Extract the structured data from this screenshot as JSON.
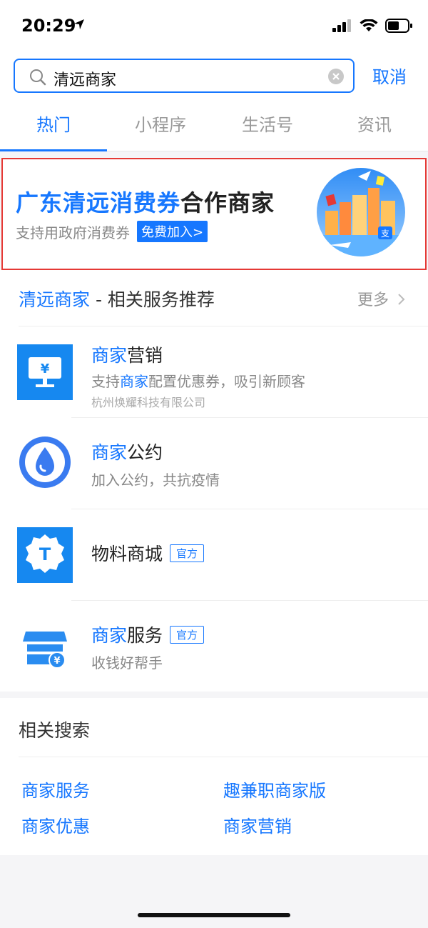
{
  "status": {
    "time": "20:29"
  },
  "search": {
    "query": "清远商家",
    "cancel_label": "取消"
  },
  "tabs": [
    {
      "label": "热门"
    },
    {
      "label": "小程序"
    },
    {
      "label": "生活号"
    },
    {
      "label": "资讯"
    }
  ],
  "banner": {
    "title_highlight": "广东清远消费券",
    "title_rest": "合作商家",
    "subtitle": "支持用政府消费券",
    "join_label": "免费加入>"
  },
  "services": {
    "title_highlight": "清远商家",
    "title_rest": " - 相关服务推荐",
    "more_label": "更多",
    "items": [
      {
        "title_hl": "商家",
        "title_rest": "营销",
        "desc_a": "支持",
        "desc_hl": "商家",
        "desc_b": "配置优惠券，吸引新顾客",
        "company": "杭州焕耀科技有限公司"
      },
      {
        "title_hl": "商家",
        "title_rest": "公约",
        "desc": "加入公约，共抗疫情"
      },
      {
        "title": "物料商城",
        "badge": "官方"
      },
      {
        "title_hl": "商家",
        "title_rest": "服务",
        "badge": "官方",
        "desc": "收钱好帮手"
      }
    ]
  },
  "related": {
    "title": "相关搜索",
    "links": [
      "商家服务",
      "趣兼职商家版",
      "商家优惠",
      "商家营销"
    ]
  },
  "colors": {
    "accent": "#1677ff",
    "highlight_border": "#e53935"
  }
}
